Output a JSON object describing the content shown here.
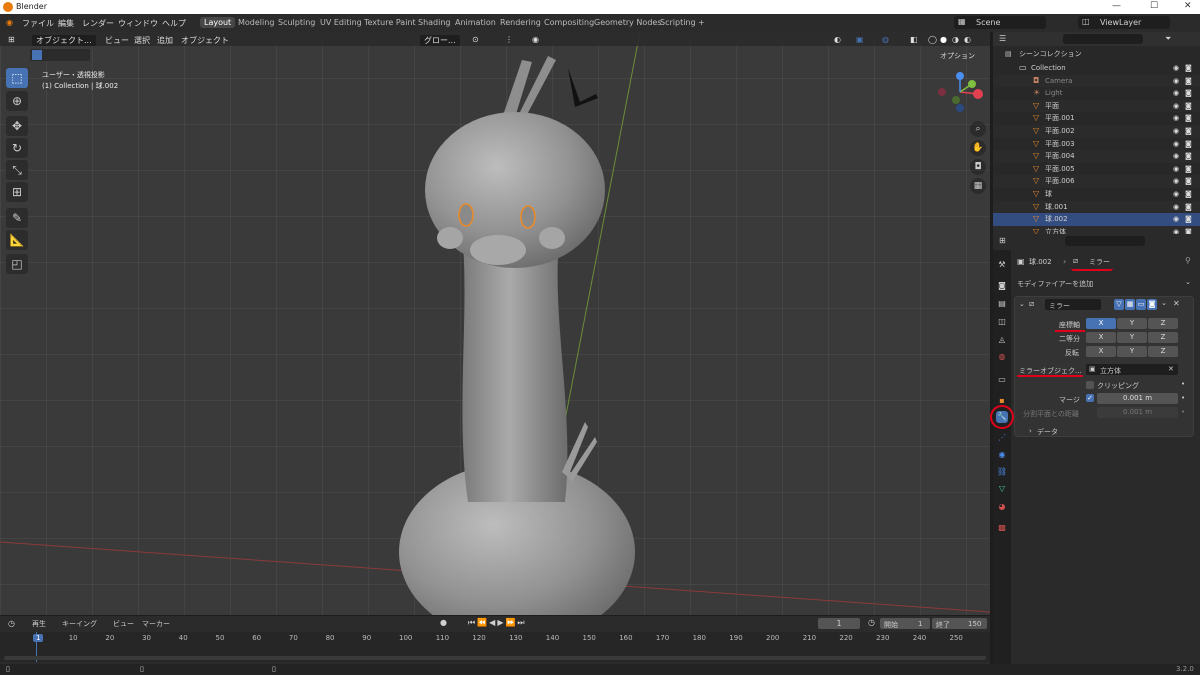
{
  "titlebar": {
    "title": "Blender"
  },
  "menu": {
    "items": [
      "ファイル",
      "編集",
      "レンダー",
      "ウィンドウ",
      "ヘルプ"
    ],
    "workspaces": [
      "Layout",
      "Modeling",
      "Sculpting",
      "UV Editing",
      "Texture Paint",
      "Shading",
      "Animation",
      "Rendering",
      "Compositing",
      "Geometry Nodes",
      "Scripting"
    ],
    "add_tab": "+",
    "scene": "Scene",
    "view_layer": "ViewLayer"
  },
  "viewport": {
    "mode": "オブジェクト...",
    "view": "ビュー",
    "select": "選択",
    "add": "追加",
    "object": "オブジェクト",
    "transform": "グロー...",
    "options": "オプション",
    "view_name": "ユーザー・透視投影",
    "collection_info": "(1) Collection | 球.002"
  },
  "outliner": {
    "root": "シーンコレクション",
    "rows": [
      {
        "name": "Collection"
      },
      {
        "name": "Camera"
      },
      {
        "name": "Light"
      },
      {
        "name": "平面"
      },
      {
        "name": "平面.001"
      },
      {
        "name": "平面.002"
      },
      {
        "name": "平面.003"
      },
      {
        "name": "平面.004"
      },
      {
        "name": "平面.005"
      },
      {
        "name": "平面.006"
      },
      {
        "name": "球"
      },
      {
        "name": "球.001"
      },
      {
        "name": "球.002"
      },
      {
        "name": "立方体"
      }
    ]
  },
  "properties": {
    "object": "球.002",
    "modifier_crumb": "ミラー",
    "add_modifier": "モディファイアーを追加",
    "modifier_name": "ミラー",
    "axis_label": "座標軸",
    "bisect_label": "二等分",
    "flip_label": "反転",
    "x": "X",
    "y": "Y",
    "z": "Z",
    "mirror_object_label": "ミラーオブジェク...",
    "mirror_object_value": "立方体",
    "clipping": "クリッピング",
    "merge_label": "マージ",
    "merge_value": "0.001 m",
    "bisect_distance_label": "分割平面との距離",
    "bisect_distance_value": "0.001 m",
    "data_label": "データ"
  },
  "timeline": {
    "playback": "再生",
    "keying": "キーイング",
    "view": "ビュー",
    "marker": "マーカー",
    "current_frame": "1",
    "start_label": "開始",
    "start": "1",
    "end_label": "終了",
    "end": "150",
    "ticks": [
      "1",
      "10",
      "20",
      "30",
      "40",
      "50",
      "60",
      "70",
      "80",
      "90",
      "100",
      "110",
      "120",
      "130",
      "140",
      "150",
      "160",
      "170",
      "180",
      "190",
      "200",
      "210",
      "220",
      "230",
      "240",
      "250"
    ]
  },
  "status": {
    "version": "3.2.0"
  },
  "colors": {
    "accent": "#4772b3",
    "annotation": "#e0001a",
    "header": "#2b2b2b",
    "viewport": "#3a3a3a"
  }
}
